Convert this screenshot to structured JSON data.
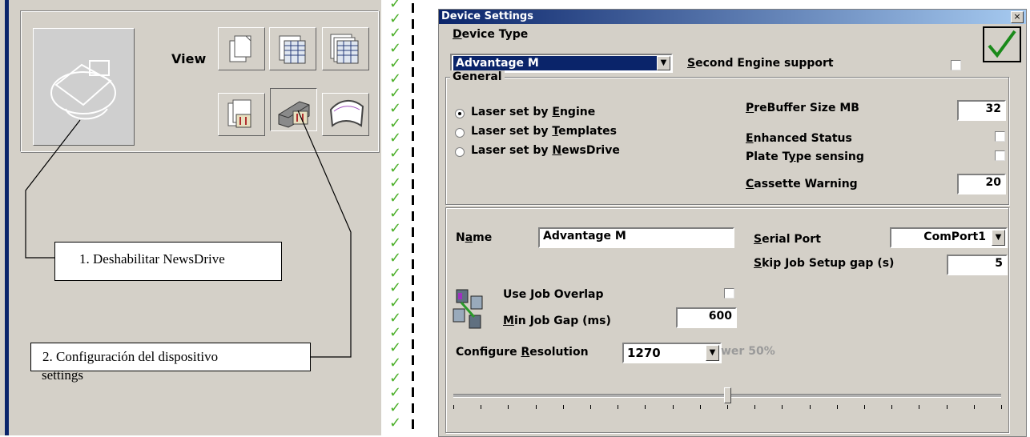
{
  "left": {
    "view_label": "View",
    "callouts": [
      {
        "text": "1. Deshabilitar NewsDrive"
      },
      {
        "text": "2.  Configuración del dispositivo"
      },
      {
        "text": "settings"
      }
    ]
  },
  "dialog": {
    "title": "Device Settings",
    "close_glyph": "×",
    "device_type": {
      "label_pre": "",
      "label_u": "D",
      "label_post": "evice Type",
      "selected": "Advantage M"
    },
    "second_engine": {
      "u": "S",
      "rest": "econd Engine support",
      "checked": false
    },
    "general": {
      "title": "General",
      "radios": [
        {
          "pre": "Laser set by ",
          "u": "E",
          "post": "ngine",
          "checked": true
        },
        {
          "pre": "Laser set by ",
          "u": "T",
          "post": "emplates",
          "checked": false
        },
        {
          "pre": "Laser set by ",
          "u": "N",
          "post": "ewsDrive",
          "checked": false
        }
      ],
      "prebuffer": {
        "u": "P",
        "rest": "reBuffer Size MB",
        "value": "32"
      },
      "enhanced": {
        "u": "E",
        "rest": "nhanced Status",
        "checked": false
      },
      "plate_pre": "Plate T",
      "plate_u": "y",
      "plate_post": "pe sensing",
      "cassette": {
        "u": "C",
        "rest": "assette Warning",
        "value": "20"
      }
    },
    "engine": {
      "name_pre": "N",
      "name_u": "a",
      "name_post": "me",
      "name_value": "Advantage M",
      "serial": {
        "u": "S",
        "rest": "erial Port",
        "value": "ComPort1"
      },
      "skip": {
        "u": "S",
        "rest": "kip Job Setup gap (s)",
        "value": "5"
      },
      "overlap_label": "Use Job Overlap",
      "mingap": {
        "u": "M",
        "rest": "in Job Gap (ms)",
        "value": "600"
      },
      "resolution": {
        "pre": "Configure ",
        "u": "R",
        "post": "esolution",
        "value": "1270"
      },
      "power_text": "wer 50%",
      "slider_level": 0.5
    }
  },
  "colors": {
    "accent": "#0a246a",
    "check": "#4caf2a"
  }
}
